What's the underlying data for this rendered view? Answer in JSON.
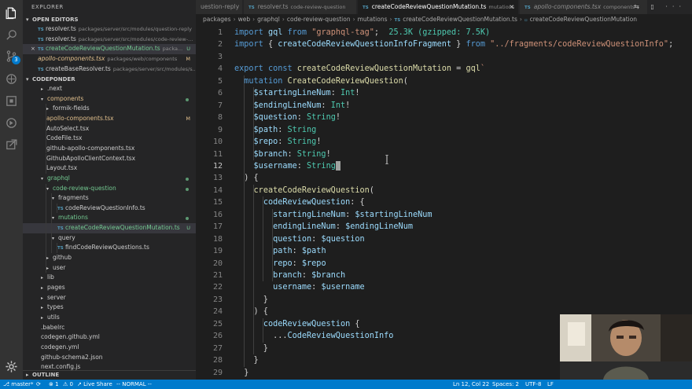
{
  "sidebar": {
    "title": "EXPLORER",
    "open_editors_label": "OPEN EDITORS",
    "open_editors": [
      {
        "name": "resolver.ts",
        "path": "packages/server/src/modules/question-reply",
        "badge": "",
        "selected": false,
        "modified": false
      },
      {
        "name": "resolver.ts",
        "path": "packages/server/src/modules/code-review-...",
        "badge": "",
        "selected": false,
        "modified": false
      },
      {
        "name": "createCodeReviewQuestionMutation.ts",
        "path": "packa...",
        "badge": "U",
        "selected": true,
        "modified": true
      },
      {
        "name": "apollo-components.tsx",
        "path": "packages/web/components",
        "badge": "M",
        "selected": false,
        "modified": false
      },
      {
        "name": "createBaseResolver.ts",
        "path": "packages/server/src/modules/s...",
        "badge": "",
        "selected": false,
        "modified": false
      }
    ],
    "project_label": "CODEPONDER",
    "tree": [
      {
        "name": ".next",
        "type": "folder",
        "open": false,
        "depth": 1,
        "color": "",
        "badge": "",
        "dot": false
      },
      {
        "name": "components",
        "type": "folder",
        "open": true,
        "depth": 1,
        "color": "orange",
        "badge": "",
        "dot": true
      },
      {
        "name": "formik-fields",
        "type": "folder",
        "open": false,
        "depth": 2,
        "color": "",
        "badge": "",
        "dot": false
      },
      {
        "name": "apollo-components.tsx",
        "type": "file",
        "depth": 2,
        "color": "orange",
        "badge": "M",
        "dot": false
      },
      {
        "name": "AutoSelect.tsx",
        "type": "file",
        "depth": 2,
        "color": "",
        "badge": "",
        "dot": false
      },
      {
        "name": "CodeFile.tsx",
        "type": "file",
        "depth": 2,
        "color": "",
        "badge": "",
        "dot": false
      },
      {
        "name": "github-apollo-components.tsx",
        "type": "file",
        "depth": 2,
        "color": "",
        "badge": "",
        "dot": false
      },
      {
        "name": "GithubApolloClientContext.tsx",
        "type": "file",
        "depth": 2,
        "color": "",
        "badge": "",
        "dot": false
      },
      {
        "name": "Layout.tsx",
        "type": "file",
        "depth": 2,
        "color": "",
        "badge": "",
        "dot": false
      },
      {
        "name": "graphql",
        "type": "folder",
        "open": true,
        "depth": 1,
        "color": "green",
        "badge": "",
        "dot": true
      },
      {
        "name": "code-review-question",
        "type": "folder",
        "open": true,
        "depth": 2,
        "color": "green",
        "badge": "",
        "dot": true
      },
      {
        "name": "fragments",
        "type": "folder",
        "open": true,
        "depth": 3,
        "color": "",
        "badge": "",
        "dot": false
      },
      {
        "name": "codeReviewQuestionInfo.ts",
        "type": "file",
        "depth": 4,
        "color": "",
        "badge": "",
        "dot": false
      },
      {
        "name": "mutations",
        "type": "folder",
        "open": true,
        "depth": 3,
        "color": "green",
        "badge": "",
        "dot": true
      },
      {
        "name": "createCodeReviewQuestionMutation.ts",
        "type": "file",
        "depth": 4,
        "color": "green",
        "badge": "U",
        "dot": false,
        "selected": true
      },
      {
        "name": "query",
        "type": "folder",
        "open": true,
        "depth": 3,
        "color": "",
        "badge": "",
        "dot": false
      },
      {
        "name": "findCodeReviewQuestions.ts",
        "type": "file",
        "depth": 4,
        "color": "",
        "badge": "",
        "dot": false
      },
      {
        "name": "github",
        "type": "folder",
        "open": false,
        "depth": 2,
        "color": "",
        "badge": "",
        "dot": false
      },
      {
        "name": "user",
        "type": "folder",
        "open": false,
        "depth": 2,
        "color": "",
        "badge": "",
        "dot": false
      },
      {
        "name": "lib",
        "type": "folder",
        "open": false,
        "depth": 1,
        "color": "",
        "badge": "",
        "dot": false
      },
      {
        "name": "pages",
        "type": "folder",
        "open": false,
        "depth": 1,
        "color": "",
        "badge": "",
        "dot": false
      },
      {
        "name": "server",
        "type": "folder",
        "open": false,
        "depth": 1,
        "color": "",
        "badge": "",
        "dot": false
      },
      {
        "name": "types",
        "type": "folder",
        "open": false,
        "depth": 1,
        "color": "",
        "badge": "",
        "dot": false
      },
      {
        "name": "utils",
        "type": "folder",
        "open": false,
        "depth": 1,
        "color": "",
        "badge": "",
        "dot": false
      },
      {
        "name": ".babelrc",
        "type": "file",
        "depth": 1,
        "color": "",
        "badge": "",
        "dot": false
      },
      {
        "name": "codegen.github.yml",
        "type": "file",
        "depth": 1,
        "color": "",
        "badge": "",
        "dot": false
      },
      {
        "name": "codegen.yml",
        "type": "file",
        "depth": 1,
        "color": "",
        "badge": "",
        "dot": false
      },
      {
        "name": "github-schema2.json",
        "type": "file",
        "depth": 1,
        "color": "",
        "badge": "",
        "dot": false
      },
      {
        "name": "next.config.js",
        "type": "file",
        "depth": 1,
        "color": "",
        "badge": "",
        "dot": false
      }
    ],
    "outline_label": "OUTLINE"
  },
  "tabs": [
    {
      "name": "uestion-reply",
      "desc": "",
      "active": false,
      "icon": ""
    },
    {
      "name": "resolver.ts",
      "desc": "code-review-question",
      "active": false,
      "icon": "TS"
    },
    {
      "name": "createCodeReviewQuestionMutation.ts",
      "desc": "mutations",
      "active": true,
      "icon": "TS"
    },
    {
      "name": "apollo-components.tsx",
      "desc": "components",
      "active": false,
      "icon": "TS"
    }
  ],
  "tab_actions": "⇆ ▯ ···",
  "breadcrumb": [
    "packages",
    "web",
    "graphql",
    "code-review-question",
    "mutations",
    "createCodeReviewQuestionMutation.ts",
    "createCodeReviewQuestionMutation"
  ],
  "editor": {
    "current_line": 12,
    "lines": [
      [
        [
          "kw",
          "import"
        ],
        [
          "txt",
          " "
        ],
        [
          "var",
          "gql"
        ],
        [
          "txt",
          " "
        ],
        [
          "kw",
          "from"
        ],
        [
          "txt",
          " "
        ],
        [
          "str",
          "\"graphql-tag\""
        ],
        [
          "txt",
          ";  "
        ],
        [
          "grn",
          "25.3K (gzipped: 7.5K)"
        ]
      ],
      [
        [
          "kw",
          "import"
        ],
        [
          "txt",
          " { "
        ],
        [
          "var",
          "createCodeReviewQuestionInfoFragment"
        ],
        [
          "txt",
          " } "
        ],
        [
          "kw",
          "from"
        ],
        [
          "txt",
          " "
        ],
        [
          "str",
          "\"../fragments/codeReviewQuestionInfo\""
        ],
        [
          "txt",
          ";"
        ]
      ],
      [],
      [
        [
          "kw",
          "export"
        ],
        [
          "txt",
          " "
        ],
        [
          "kw",
          "const"
        ],
        [
          "txt",
          " "
        ],
        [
          "fn",
          "createCodeReviewQuestionMutation"
        ],
        [
          "txt",
          " = "
        ],
        [
          "fn",
          "gql"
        ],
        [
          "str",
          "`"
        ]
      ],
      [
        [
          "str",
          "  "
        ],
        [
          "kw",
          "mutation"
        ],
        [
          "txt",
          " "
        ],
        [
          "fn",
          "CreateCodeReviewQuestion"
        ],
        [
          "txt",
          "("
        ]
      ],
      [
        [
          "txt",
          "    "
        ],
        [
          "var",
          "$startingLineNum"
        ],
        [
          "txt",
          ": "
        ],
        [
          "typ",
          "Int"
        ],
        [
          "txt",
          "!"
        ]
      ],
      [
        [
          "txt",
          "    "
        ],
        [
          "var",
          "$endingLineNum"
        ],
        [
          "txt",
          ": "
        ],
        [
          "typ",
          "Int"
        ],
        [
          "txt",
          "!"
        ]
      ],
      [
        [
          "txt",
          "    "
        ],
        [
          "var",
          "$question"
        ],
        [
          "txt",
          ": "
        ],
        [
          "typ",
          "String"
        ],
        [
          "txt",
          "!"
        ]
      ],
      [
        [
          "txt",
          "    "
        ],
        [
          "var",
          "$path"
        ],
        [
          "txt",
          ": "
        ],
        [
          "typ",
          "String"
        ]
      ],
      [
        [
          "txt",
          "    "
        ],
        [
          "var",
          "$repo"
        ],
        [
          "txt",
          ": "
        ],
        [
          "typ",
          "String"
        ],
        [
          "txt",
          "!"
        ]
      ],
      [
        [
          "txt",
          "    "
        ],
        [
          "var",
          "$branch"
        ],
        [
          "txt",
          ": "
        ],
        [
          "typ",
          "String"
        ],
        [
          "txt",
          "!"
        ]
      ],
      [
        [
          "txt",
          "    "
        ],
        [
          "var",
          "$username"
        ],
        [
          "txt",
          ": "
        ],
        [
          "typ",
          "String"
        ]
      ],
      [
        [
          "txt",
          "  ) {"
        ]
      ],
      [
        [
          "txt",
          "    "
        ],
        [
          "fn",
          "createCodeReviewQuestion"
        ],
        [
          "txt",
          "("
        ]
      ],
      [
        [
          "txt",
          "      "
        ],
        [
          "var",
          "codeReviewQuestion"
        ],
        [
          "txt",
          ": {"
        ]
      ],
      [
        [
          "txt",
          "        "
        ],
        [
          "var",
          "startingLineNum"
        ],
        [
          "txt",
          ": "
        ],
        [
          "var",
          "$startingLineNum"
        ]
      ],
      [
        [
          "txt",
          "        "
        ],
        [
          "var",
          "endingLineNum"
        ],
        [
          "txt",
          ": "
        ],
        [
          "var",
          "$endingLineNum"
        ]
      ],
      [
        [
          "txt",
          "        "
        ],
        [
          "var",
          "question"
        ],
        [
          "txt",
          ": "
        ],
        [
          "var",
          "$question"
        ]
      ],
      [
        [
          "txt",
          "        "
        ],
        [
          "var",
          "path"
        ],
        [
          "txt",
          ": "
        ],
        [
          "var",
          "$path"
        ]
      ],
      [
        [
          "txt",
          "        "
        ],
        [
          "var",
          "repo"
        ],
        [
          "txt",
          ": "
        ],
        [
          "var",
          "$repo"
        ]
      ],
      [
        [
          "txt",
          "        "
        ],
        [
          "var",
          "branch"
        ],
        [
          "txt",
          ": "
        ],
        [
          "var",
          "$branch"
        ]
      ],
      [
        [
          "txt",
          "        "
        ],
        [
          "var",
          "username"
        ],
        [
          "txt",
          ": "
        ],
        [
          "var",
          "$username"
        ]
      ],
      [
        [
          "txt",
          "      }"
        ]
      ],
      [
        [
          "txt",
          "    ) {"
        ]
      ],
      [
        [
          "txt",
          "      "
        ],
        [
          "var",
          "codeReviewQuestion"
        ],
        [
          "txt",
          " {"
        ]
      ],
      [
        [
          "txt",
          "        ..."
        ],
        [
          "var",
          "CodeReviewQuestionInfo"
        ]
      ],
      [
        [
          "txt",
          "      }"
        ]
      ],
      [
        [
          "txt",
          "    }"
        ]
      ],
      [
        [
          "txt",
          "  }"
        ]
      ]
    ]
  },
  "statusbar": {
    "branch": "master*",
    "sync": "⟳",
    "errors": "⊗ 1",
    "warnings": "⚠ 0",
    "live_share": "Live Share",
    "mode": "-- NORMAL --",
    "cursor": "Ln 12, Col 22",
    "spaces": "Spaces: 2",
    "encoding": "UTF-8",
    "eol": "LF",
    "feedback_icon": "smiley-icon",
    "bell_icon": "bell-icon"
  },
  "activity_badge": "3",
  "colors": {
    "status_bg": "#007acc",
    "keyword": "#569cd6",
    "function": "#dcdcaa",
    "string": "#ce9178",
    "variable": "#9cdcfe",
    "type": "#4ec9b0"
  }
}
